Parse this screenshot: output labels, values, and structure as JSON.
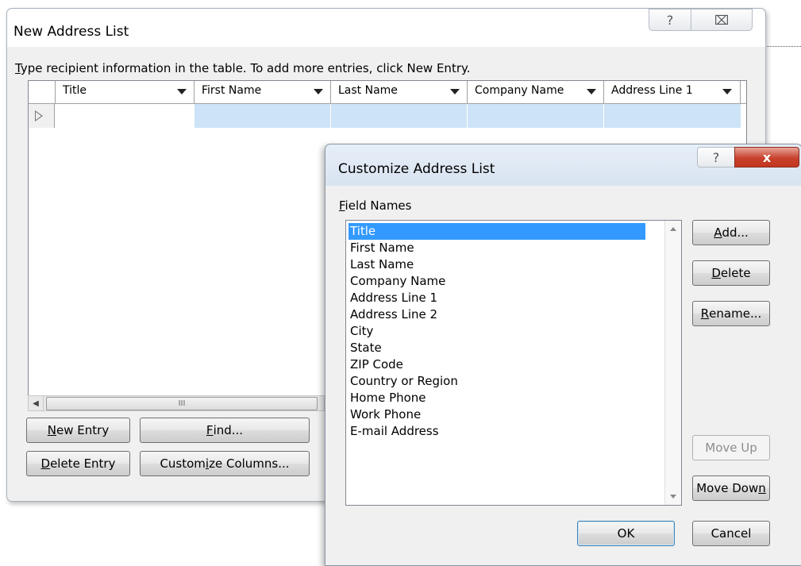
{
  "main_window": {
    "title": "New Address List",
    "help_glyph": "?",
    "close_glyph": "⌧",
    "instruction_prefix": "T",
    "instruction_rest": "ype recipient information in the table.  To add more entries, click New Entry.",
    "columns": [
      "Title",
      "First Name",
      "Last Name",
      "Company Name",
      "Address Line 1"
    ],
    "scroll_grip": "III",
    "buttons": {
      "new_entry_key": "N",
      "new_entry_rest": "ew Entry",
      "find_key": "F",
      "find_rest": "ind...",
      "delete_entry_key": "D",
      "delete_entry_rest": "elete Entry",
      "customize_pre": "Custom",
      "customize_key": "i",
      "customize_post": "ze Columns..."
    }
  },
  "dialog": {
    "title": "Customize Address List",
    "help_glyph": "?",
    "close_glyph": "x",
    "field_names_key": "F",
    "field_names_rest": "ield Names",
    "fields": [
      "Title",
      "First Name",
      "Last Name",
      "Company Name",
      "Address Line 1",
      "Address Line 2",
      "City",
      "State",
      "ZIP Code",
      "Country or Region",
      "Home Phone",
      "Work Phone",
      "E-mail Address"
    ],
    "selected_field": "Title",
    "buttons": {
      "add_key": "A",
      "add_rest": "dd...",
      "delete_key": "D",
      "delete_rest": "elete",
      "rename_key": "R",
      "rename_rest": "ename...",
      "move_up": "Move Up",
      "move_down_pre": "Move Dow",
      "move_down_key": "n",
      "ok": "OK",
      "cancel": "Cancel"
    }
  }
}
